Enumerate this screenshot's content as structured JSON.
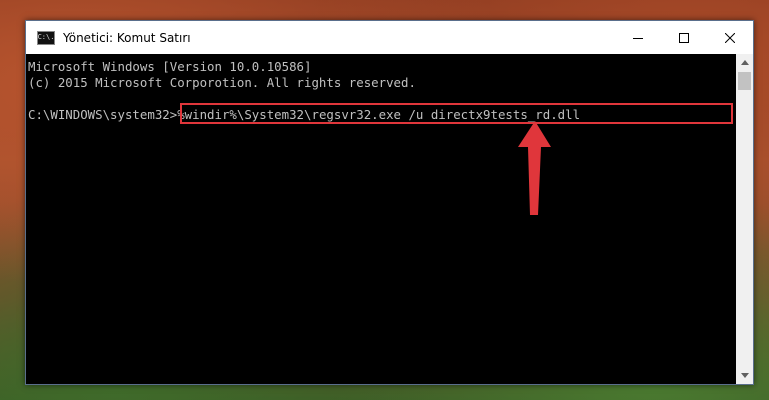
{
  "window": {
    "title": "Yönetici: Komut Satırı",
    "icon": "cmd-icon",
    "icon_label": "C:\\."
  },
  "controls": [
    "minimize-icon",
    "maximize-icon",
    "close-icon"
  ],
  "console": {
    "lines": [
      "Microsoft Windows [Version 10.0.10586]",
      "(c) 2015 Microsoft Corporotion. All rights reserved."
    ],
    "prompt": "C:\\WINDOWS\\system32>",
    "command": "%windir%\\System32\\regsvr32.exe /u directx9tests_rd.dll"
  },
  "colors": {
    "console_text": "#c0c0c0",
    "highlight_border": "#e0363b",
    "arrow": "#e0363b"
  }
}
